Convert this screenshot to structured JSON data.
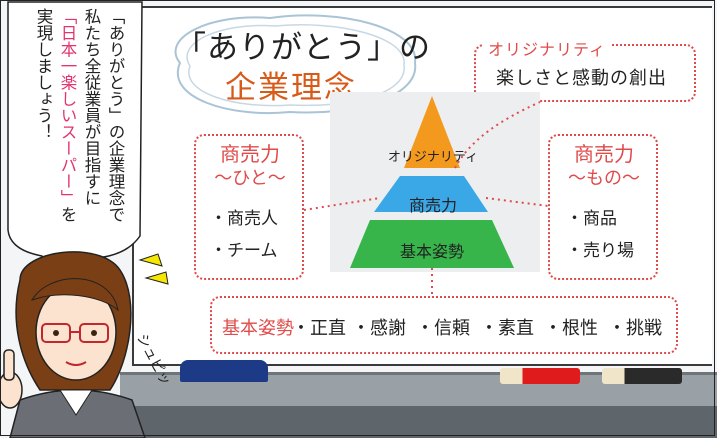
{
  "title": {
    "line1": "「ありがとう」の",
    "line2": "企業理念"
  },
  "originality_box": {
    "heading": "オリジナリティ",
    "text": "楽しさと感動の創出"
  },
  "pyramid": {
    "top": "オリジナリティ",
    "middle": "商売力",
    "bottom": "基本姿勢",
    "colors": {
      "top": "#f39a1e",
      "middle": "#3aa7e6",
      "bottom": "#37b44a"
    }
  },
  "left_box": {
    "heading": "商売力",
    "sub": "〜ひと〜",
    "items": [
      "・商売人",
      "・チーム"
    ]
  },
  "right_box": {
    "heading": "商売力",
    "sub": "〜もの〜",
    "items": [
      "・商品",
      "・売り場"
    ]
  },
  "basic_attitude": {
    "heading": "基本姿勢",
    "items": [
      "・正直",
      "・感謝",
      "・信頼",
      "・素直",
      "・根性",
      "・挑戦"
    ]
  },
  "speech_bubble": {
    "col1": "「ありがとう」の企業理念で",
    "col2": "私たち全従業員が目指すに",
    "col3_pink": "「日本一楽しいスーパー」",
    "col3_tail": "を",
    "col4": "実現しましょう！"
  },
  "sfx": "シュピッ",
  "accent_colors": {
    "red": "#e04b4b",
    "orange": "#d85a18"
  }
}
